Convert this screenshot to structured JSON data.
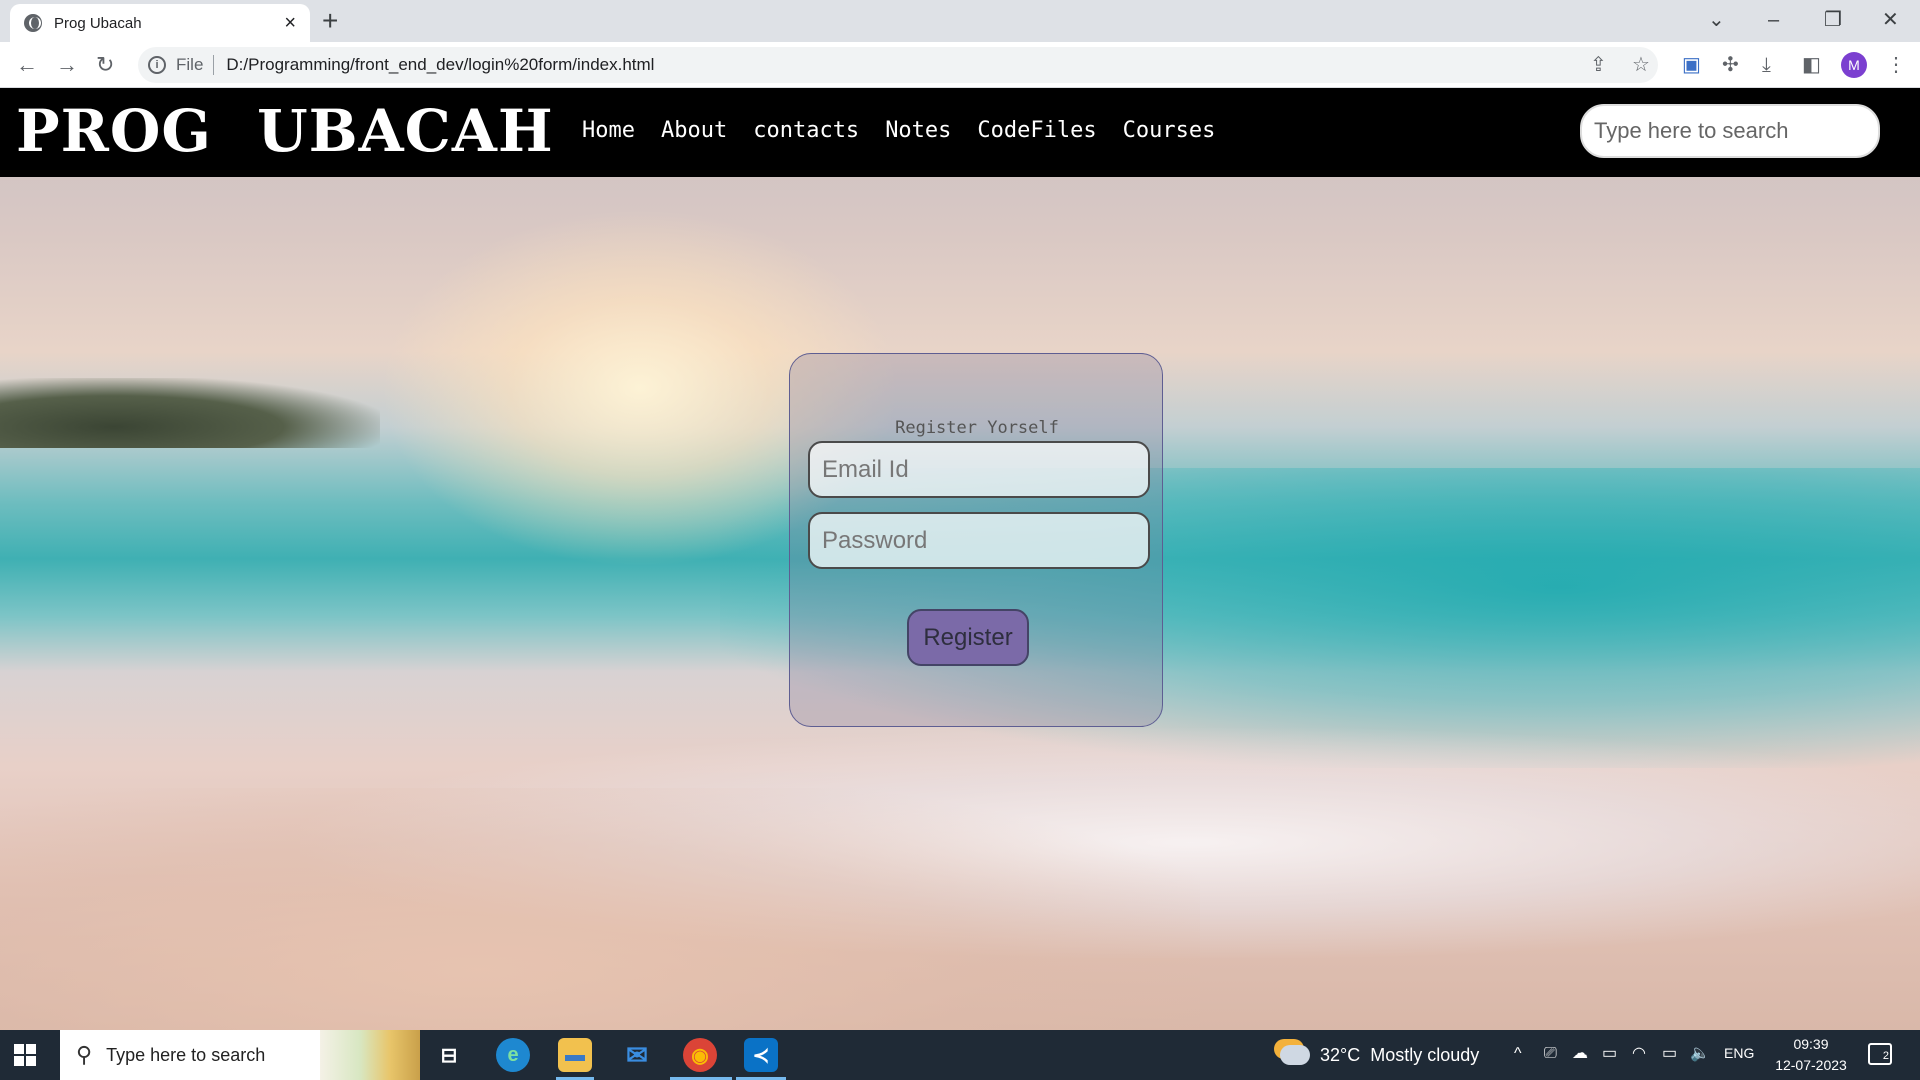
{
  "browser": {
    "tab_title": "Prog Ubacah",
    "tab_close": "×",
    "new_tab": "+",
    "window_controls": {
      "tab_search": "⌄",
      "minimize": "–",
      "restore": "❐",
      "close": "✕"
    },
    "nav": {
      "back": "←",
      "forward": "→",
      "reload": "↻"
    },
    "address": {
      "info": "i",
      "scheme_label": "File",
      "url": "D:/Programming/front_end_dev/login%20form/index.html"
    },
    "toolbar_icons": {
      "share": "⇪",
      "bookmark": "☆",
      "extension_app": "▣",
      "extensions": "✣",
      "download": "⤓",
      "side_panel": "◧",
      "menu": "⋮"
    },
    "profile_initial": "M"
  },
  "site": {
    "logo": "PROG UBACAH",
    "nav_links": [
      "Home",
      "About",
      "contacts",
      "Notes",
      "CodeFiles",
      "Courses"
    ],
    "search_placeholder": "Type here to search"
  },
  "form": {
    "title": "Register Yorself",
    "email_placeholder": "Email Id",
    "password_placeholder": "Password",
    "submit_label": "Register"
  },
  "taskbar": {
    "search_icon": "⚲",
    "search_placeholder": "Type here to search",
    "apps": [
      {
        "name": "task-view",
        "glyph": "⊟"
      },
      {
        "name": "edge",
        "glyph": "e"
      },
      {
        "name": "file-explorer",
        "glyph": "▬"
      },
      {
        "name": "mail",
        "glyph": "✉"
      },
      {
        "name": "chrome",
        "glyph": "◉"
      },
      {
        "name": "vscode",
        "glyph": "≺"
      }
    ],
    "weather": {
      "temp": "32°C",
      "condition": "Mostly cloudy"
    },
    "tray_icons": {
      "chevron": "^",
      "meet": "⎚",
      "onedrive": "☁",
      "display": "▭",
      "wifi": "◠",
      "battery": "▭",
      "volume": "🔈"
    },
    "language": "ENG",
    "time": "09:39",
    "date": "12-07-2023",
    "notification_count": "2"
  },
  "colors": {
    "navbar_bg": "#000000",
    "register_button": "#7b6aa8",
    "taskbar_bg": "#1f2a36"
  }
}
